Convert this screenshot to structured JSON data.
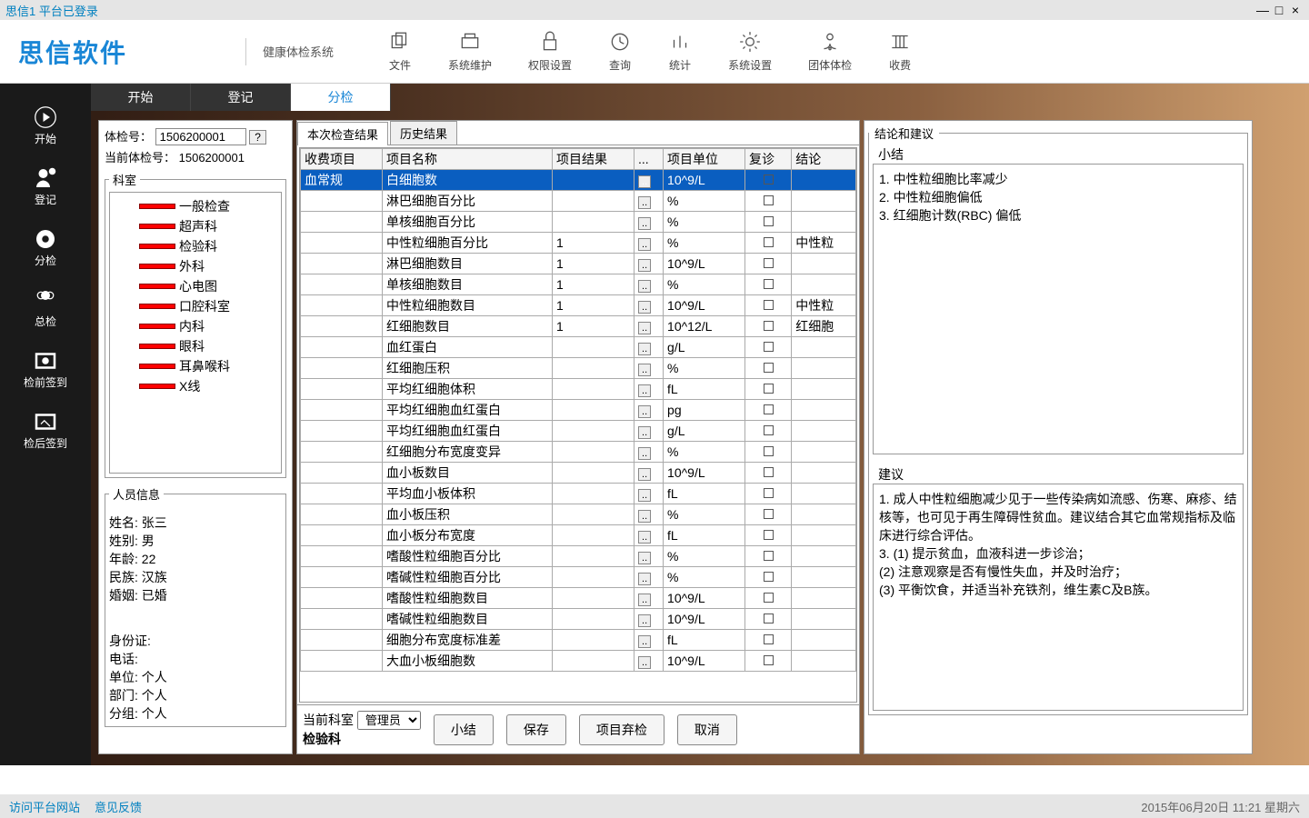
{
  "titlebar": {
    "title": "思信1 平台已登录",
    "min": "—",
    "max": "□",
    "close": "×"
  },
  "header": {
    "logo": "思信软件",
    "subtitle": "健康体检系统",
    "tools": [
      {
        "label": "文件"
      },
      {
        "label": "系统维护"
      },
      {
        "label": "权限设置"
      },
      {
        "label": "查询"
      },
      {
        "label": "统计"
      },
      {
        "label": "系统设置"
      },
      {
        "label": "团体体检"
      },
      {
        "label": "收费"
      }
    ]
  },
  "sidebar": [
    {
      "label": "开始"
    },
    {
      "label": "登记"
    },
    {
      "label": "分检"
    },
    {
      "label": "总检"
    },
    {
      "label": "检前签到"
    },
    {
      "label": "检后签到"
    }
  ],
  "tabs": [
    {
      "label": "开始",
      "active": false
    },
    {
      "label": "登记",
      "active": false
    },
    {
      "label": "分检",
      "active": true
    }
  ],
  "left": {
    "id_label": "体检号：",
    "id_value": "1506200001",
    "help": "?",
    "current_label": "当前体检号：",
    "current_value": "1506200001",
    "dept_legend": "科室",
    "departments": [
      "一般检查",
      "超声科",
      "检验科",
      "外科",
      "心电图",
      "口腔科室",
      "内科",
      "眼科",
      "耳鼻喉科",
      "X线"
    ],
    "person_legend": "人员信息",
    "person": {
      "name_l": "姓名:",
      "name_v": "张三",
      "sex_l": "姓别:",
      "sex_v": "男",
      "age_l": "年龄:",
      "age_v": "22",
      "nation_l": "民族:",
      "nation_v": "汉族",
      "marry_l": "婚姻:",
      "marry_v": "已婚",
      "idcard_l": "身份证:",
      "idcard_v": "",
      "phone_l": "电话:",
      "phone_v": "",
      "unit_l": "单位:",
      "unit_v": "个人",
      "dept_l": "部门:",
      "dept_v": "个人",
      "group_l": "分组:",
      "group_v": "个人"
    }
  },
  "mid": {
    "subtab1": "本次检查结果",
    "subtab2": "历史结果",
    "headers": [
      "收费项目",
      "项目名称",
      "项目结果",
      "...",
      "项目单位",
      "复诊",
      "结论"
    ],
    "fee_item": "血常规",
    "rows": [
      {
        "name": "白细胞数",
        "result": "",
        "unit": "10^9/L",
        "concl": "",
        "sel": true
      },
      {
        "name": "淋巴细胞百分比",
        "result": "",
        "unit": "%",
        "concl": ""
      },
      {
        "name": "单核细胞百分比",
        "result": "",
        "unit": "%",
        "concl": ""
      },
      {
        "name": "中性粒细胞百分比",
        "result": "1",
        "unit": "%",
        "concl": "中性粒"
      },
      {
        "name": "淋巴细胞数目",
        "result": "1",
        "unit": "10^9/L",
        "concl": ""
      },
      {
        "name": "单核细胞数目",
        "result": "1",
        "unit": "%",
        "concl": ""
      },
      {
        "name": "中性粒细胞数目",
        "result": "1",
        "unit": "10^9/L",
        "concl": "中性粒"
      },
      {
        "name": "红细胞数目",
        "result": "1",
        "unit": "10^12/L",
        "concl": "红细胞"
      },
      {
        "name": "血红蛋白",
        "result": "",
        "unit": "g/L",
        "concl": ""
      },
      {
        "name": "红细胞压积",
        "result": "",
        "unit": "%",
        "concl": ""
      },
      {
        "name": "平均红细胞体积",
        "result": "",
        "unit": "fL",
        "concl": ""
      },
      {
        "name": "平均红细胞血红蛋白",
        "result": "",
        "unit": "pg",
        "concl": ""
      },
      {
        "name": "平均红细胞血红蛋白",
        "result": "",
        "unit": "g/L",
        "concl": ""
      },
      {
        "name": "红细胞分布宽度变异",
        "result": "",
        "unit": "%",
        "concl": ""
      },
      {
        "name": "血小板数目",
        "result": "",
        "unit": "10^9/L",
        "concl": ""
      },
      {
        "name": "平均血小板体积",
        "result": "",
        "unit": "fL",
        "concl": ""
      },
      {
        "name": "血小板压积",
        "result": "",
        "unit": "%",
        "concl": ""
      },
      {
        "name": "血小板分布宽度",
        "result": "",
        "unit": "fL",
        "concl": ""
      },
      {
        "name": "嗜酸性粒细胞百分比",
        "result": "",
        "unit": "%",
        "concl": ""
      },
      {
        "name": "嗜碱性粒细胞百分比",
        "result": "",
        "unit": "%",
        "concl": ""
      },
      {
        "name": "嗜酸性粒细胞数目",
        "result": "",
        "unit": "10^9/L",
        "concl": ""
      },
      {
        "name": "嗜碱性粒细胞数目",
        "result": "",
        "unit": "10^9/L",
        "concl": ""
      },
      {
        "name": "细胞分布宽度标准差",
        "result": "",
        "unit": "fL",
        "concl": ""
      },
      {
        "name": "大血小板细胞数",
        "result": "",
        "unit": "10^9/L",
        "concl": ""
      }
    ],
    "bottom": {
      "dept_label": "当前科室",
      "dept_sub": "检验科",
      "admin": "管理员",
      "btn_summary": "小结",
      "btn_save": "保存",
      "btn_discard": "项目弃检",
      "btn_cancel": "取消"
    }
  },
  "right": {
    "legend": "结论和建议",
    "summary_tab": "小结",
    "summary_lines": [
      "1. 中性粒细胞比率减少",
      "2. 中性粒细胞偏低",
      "3. 红细胞计数(RBC) 偏低"
    ],
    "advice_tab": "建议",
    "advice_lines": [
      "1. 成人中性粒细胞减少见于一些传染病如流感、伤寒、麻疹、结核等，也可见于再生障碍性贫血。建议结合其它血常规指标及临床进行综合评估。",
      "3. (1) 提示贫血，血液科进一步诊治；",
      "(2) 注意观察是否有慢性失血，并及时治疗；",
      "(3) 平衡饮食，并适当补充铁剂，维生素C及B族。"
    ]
  },
  "status": {
    "link1": "访问平台网站",
    "link2": "意见反馈",
    "time": "2015年06月20日 11:21 星期六"
  }
}
